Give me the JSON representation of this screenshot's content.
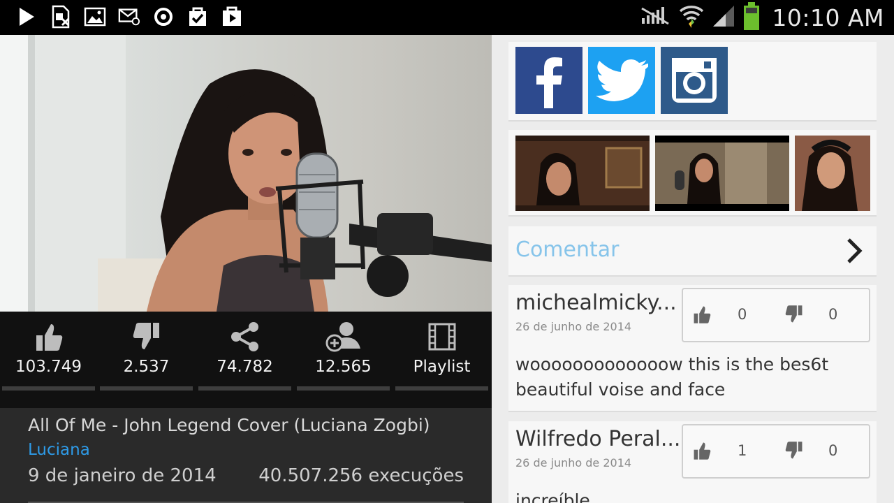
{
  "status_bar": {
    "left_icons": [
      "play-store-icon",
      "excel-file-icon",
      "image-icon",
      "email-icon",
      "sync-icon",
      "task-check-icon",
      "video-play-icon"
    ],
    "right_icons": [
      "no-signal-icon",
      "wifi-icon",
      "cell-signal-icon",
      "battery-icon"
    ],
    "time": "10:10 AM"
  },
  "stats": [
    {
      "icon": "thumbs-up-icon",
      "value": "103.749"
    },
    {
      "icon": "thumbs-down-icon",
      "value": "2.537"
    },
    {
      "icon": "share-icon",
      "value": "74.782"
    },
    {
      "icon": "add-user-icon",
      "value": "12.565"
    },
    {
      "icon": "film-icon",
      "value": "Playlist"
    }
  ],
  "video_info": {
    "title": "All Of Me - John Legend Cover (Luciana Zogbi)",
    "author": "Luciana",
    "date": "9 de janeiro de 2014",
    "views": "40.507.256 execuções"
  },
  "social": [
    "facebook",
    "twitter",
    "instagram"
  ],
  "comment_prompt": "Comentar",
  "comments": [
    {
      "user": "michealmicky...",
      "date": "26 de junho de 2014",
      "likes": "0",
      "dislikes": "0",
      "text": "wooooooooooooow this is the bes6t beautiful voise and face"
    },
    {
      "user": "Wilfredo Peral...",
      "date": "26 de junho de 2014",
      "likes": "1",
      "dislikes": "0",
      "text": "increíble"
    }
  ],
  "colors": {
    "accent_blue": "#2e9be8",
    "comentar": "#86c4ea",
    "facebook": "#2d4a8e",
    "twitter": "#1da1f2",
    "instagram": "#2e5a8a"
  }
}
